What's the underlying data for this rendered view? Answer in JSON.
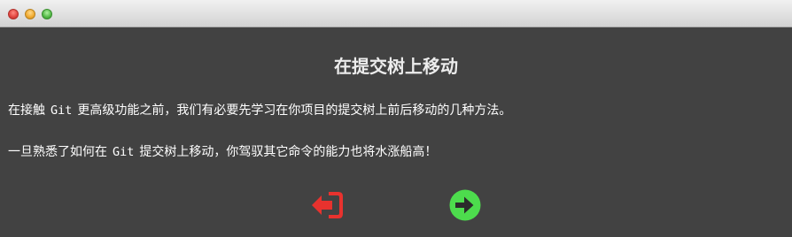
{
  "dialog": {
    "title": "在提交树上移动",
    "paragraph1": {
      "before": "在接触",
      "code": "Git",
      "after": "更高级功能之前，我们有必要先学习在你项目的提交树上前后移动的几种方法。"
    },
    "paragraph2": {
      "before": "一旦熟悉了如何在",
      "code": "Git",
      "after": "提交树上移动，你驾驭其它命令的能力也将水涨船高！"
    }
  },
  "navigation": {
    "prev_icon": "exit-icon",
    "prev_color": "#e8322e",
    "next_icon": "arrow-right-circle-icon",
    "next_color": "#4ddc4d"
  },
  "colors": {
    "background": "#424242",
    "text": "#ffffff"
  }
}
